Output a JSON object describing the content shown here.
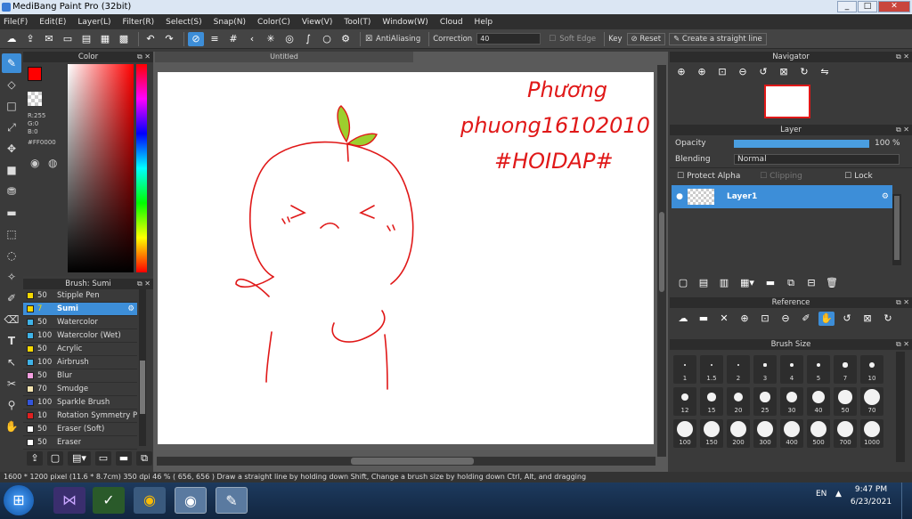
{
  "window": {
    "title": "MediBang Paint Pro (32bit)",
    "minimize": "_",
    "maximize": "□",
    "close": "✕"
  },
  "menu": [
    "File(F)",
    "Edit(E)",
    "Layer(L)",
    "Filter(R)",
    "Select(S)",
    "Snap(N)",
    "Color(C)",
    "View(V)",
    "Tool(T)",
    "Window(W)",
    "Cloud",
    "Help"
  ],
  "toolbar": {
    "antialiasing": "AntiAliasing",
    "correction_label": "Correction",
    "correction_value": "40",
    "soft_edge": "Soft Edge",
    "key_label": "Key",
    "reset": "Reset",
    "straight_line": "Create a straight line"
  },
  "color": {
    "title": "Color",
    "rgb_r": "R:255",
    "rgb_g": "G:0",
    "rgb_b": "B:0",
    "hex": "#FF0000",
    "primary": "#ff0000"
  },
  "brush": {
    "title": "Brush: Sumi",
    "items": [
      {
        "size": "50",
        "name": "Stipple Pen",
        "color": "#f5d800"
      },
      {
        "size": "7",
        "name": "Sumi",
        "color": "#f5d800"
      },
      {
        "size": "50",
        "name": "Watercolor",
        "color": "#3fb3e8"
      },
      {
        "size": "100",
        "name": "Watercolor (Wet)",
        "color": "#3fb3e8"
      },
      {
        "size": "50",
        "name": "Acrylic",
        "color": "#f5d800"
      },
      {
        "size": "100",
        "name": "Airbrush",
        "color": "#3fb3e8"
      },
      {
        "size": "50",
        "name": "Blur",
        "color": "#f59fe0"
      },
      {
        "size": "70",
        "name": "Smudge",
        "color": "#f4e4b0"
      },
      {
        "size": "100",
        "name": "Sparkle Brush",
        "color": "#3355dd"
      },
      {
        "size": "10",
        "name": "Rotation Symmetry P",
        "color": "#e02020"
      },
      {
        "size": "50",
        "name": "Eraser (Soft)",
        "color": "#ffffff"
      },
      {
        "size": "50",
        "name": "Eraser",
        "color": "#ffffff"
      }
    ]
  },
  "canvas": {
    "tab": "Untitled",
    "handwriting": {
      "line1": "Phương",
      "line2": "phuong16102010",
      "line3": "#HOIDAP#"
    }
  },
  "navigator": {
    "title": "Navigator"
  },
  "layer": {
    "title": "Layer",
    "opacity_label": "Opacity",
    "opacity_value": "100 %",
    "opacity_fraction": 1.0,
    "blending_label": "Blending",
    "blending_value": "Normal",
    "protect_alpha": "Protect Alpha",
    "clipping": "Clipping",
    "lock": "Lock",
    "layer_name": "Layer1"
  },
  "reference": {
    "title": "Reference"
  },
  "brushsize": {
    "title": "Brush Size",
    "sizes": [
      "1",
      "1.5",
      "2",
      "3",
      "4",
      "5",
      "7",
      "10",
      "12",
      "15",
      "20",
      "25",
      "30",
      "40",
      "50",
      "70",
      "100",
      "150",
      "200",
      "300",
      "400",
      "500",
      "700",
      "1000"
    ]
  },
  "status": {
    "text": "1600 * 1200 pixel   (11.6 * 8.7cm)   350 dpi   46 %   ( 656, 656 )   Draw a straight line by holding down Shift, Change a brush size by holding down Ctrl, Alt, and dragging"
  },
  "taskbar": {
    "lang": "EN",
    "time": "9:47 PM",
    "date": "6/23/2021"
  },
  "colors": {
    "accent": "#3d8ed8",
    "drawing": "#e01818",
    "sprout": "#9ccf2e"
  }
}
